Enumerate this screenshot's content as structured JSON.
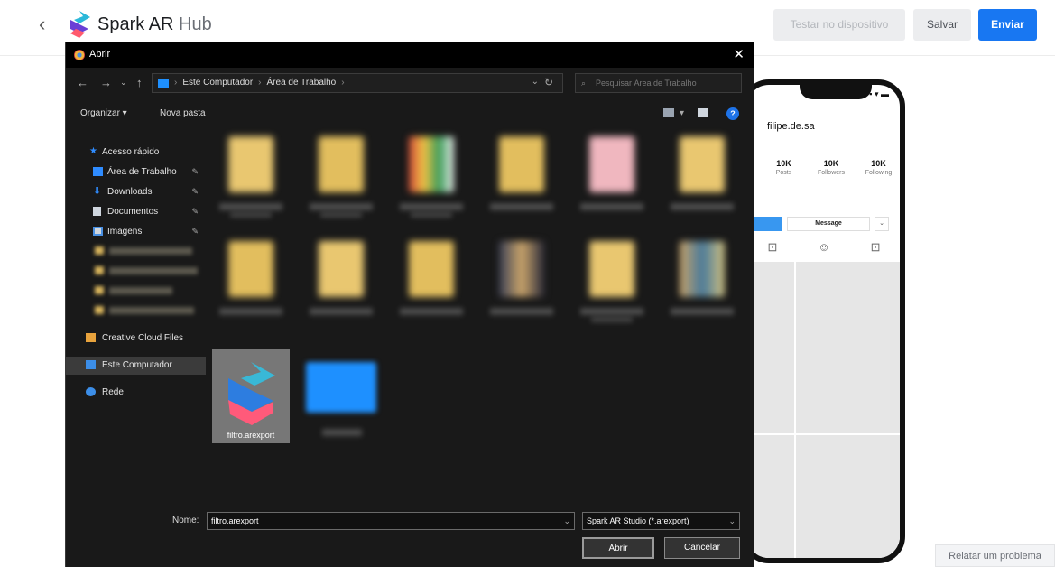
{
  "header": {
    "back_icon": "chevron-left-icon",
    "brand_main": "Spark AR",
    "brand_sub": "Hub",
    "test_label": "Testar no dispositivo",
    "save_label": "Salvar",
    "send_label": "Enviar",
    "accent": "#1877f2"
  },
  "report_label": "Relatar um problema",
  "phone": {
    "profile_name": "filipe.de.sa",
    "stats": [
      {
        "num": "10K",
        "label": "Posts"
      },
      {
        "num": "10K",
        "label": "Followers"
      },
      {
        "num": "10K",
        "label": "Following"
      }
    ],
    "message_label": "Message"
  },
  "dialog": {
    "title": "Abrir",
    "breadcrumbs": [
      "Este Computador",
      "Área de Trabalho"
    ],
    "search_placeholder": "Pesquisar Área de Trabalho",
    "toolbar": {
      "organize": "Organizar ▾",
      "new_folder": "Nova pasta"
    },
    "sidebar": {
      "quick_access": "Acesso rápido",
      "desktop": "Área de Trabalho",
      "downloads": "Downloads",
      "documents": "Documentos",
      "images": "Imagens",
      "creative_cloud": "Creative Cloud Files",
      "this_pc": "Este Computador",
      "network": "Rede"
    },
    "selected_file": "filtro.arexport",
    "filename_label": "Nome:",
    "filename_value": "filtro.arexport",
    "filetype": "Spark AR Studio (*.arexport)",
    "open_label": "Abrir",
    "cancel_label": "Cancelar"
  }
}
